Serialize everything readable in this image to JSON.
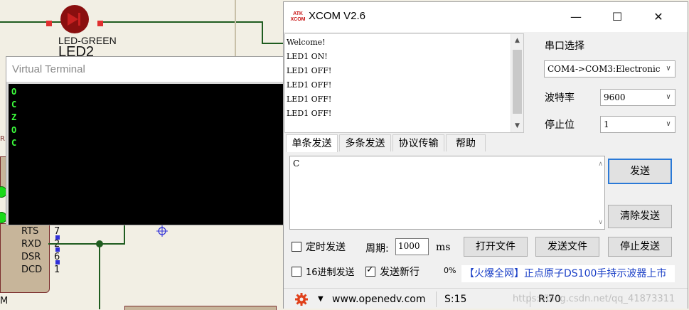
{
  "schematic": {
    "led_label": "LED-GREEN",
    "led_ref": "LED2",
    "pins": [
      {
        "name": "RTS",
        "num": "7"
      },
      {
        "name": "RXD",
        "num": "2"
      },
      {
        "name": "DSR",
        "num": "6"
      },
      {
        "name": "DCD",
        "num": "1"
      }
    ],
    "left_fragment": "M",
    "side_fragment": "RF"
  },
  "virtual_terminal": {
    "title": "Virtual Terminal",
    "lines": [
      "O",
      "C",
      "Z",
      "O",
      "C"
    ]
  },
  "xcom": {
    "title": "XCOM V2.6",
    "logo_top": "ATK",
    "logo_bottom": "XCOM",
    "window_buttons": {
      "minimize": "—",
      "maximize": "☐",
      "close": "✕"
    },
    "received_lines": [
      "Welcome!",
      "LED1 ON!",
      "LED1 OFF!",
      "LED1 OFF!",
      "LED1 OFF!",
      "LED1 OFF!"
    ],
    "port_label": "串口选择",
    "port_value": "COM4->COM3:Electronic",
    "baud_label": "波特率",
    "baud_value": "9600",
    "stop_label": "停止位",
    "stop_value": "1",
    "tabs": [
      "单条发送",
      "多条发送",
      "协议传输",
      "帮助"
    ],
    "send_text": "C",
    "send_button": "发送",
    "clear_send_button": "清除发送",
    "timed_send_label": "定时发送",
    "period_label": "周期:",
    "period_value": "1000",
    "period_unit": "ms",
    "open_file_button": "打开文件",
    "send_file_button": "发送文件",
    "stop_send_button": "停止发送",
    "hex_send_label": "16进制发送",
    "newline_label": "发送新行",
    "progress": "0%",
    "ad_text": "【火爆全网】正点原子DS100手持示波器上市",
    "status": {
      "url": "www.openedv.com",
      "s_count": "S:15",
      "r_count": "R:70"
    },
    "watermark": "https://blog.csdn.net/qq_41873311"
  }
}
